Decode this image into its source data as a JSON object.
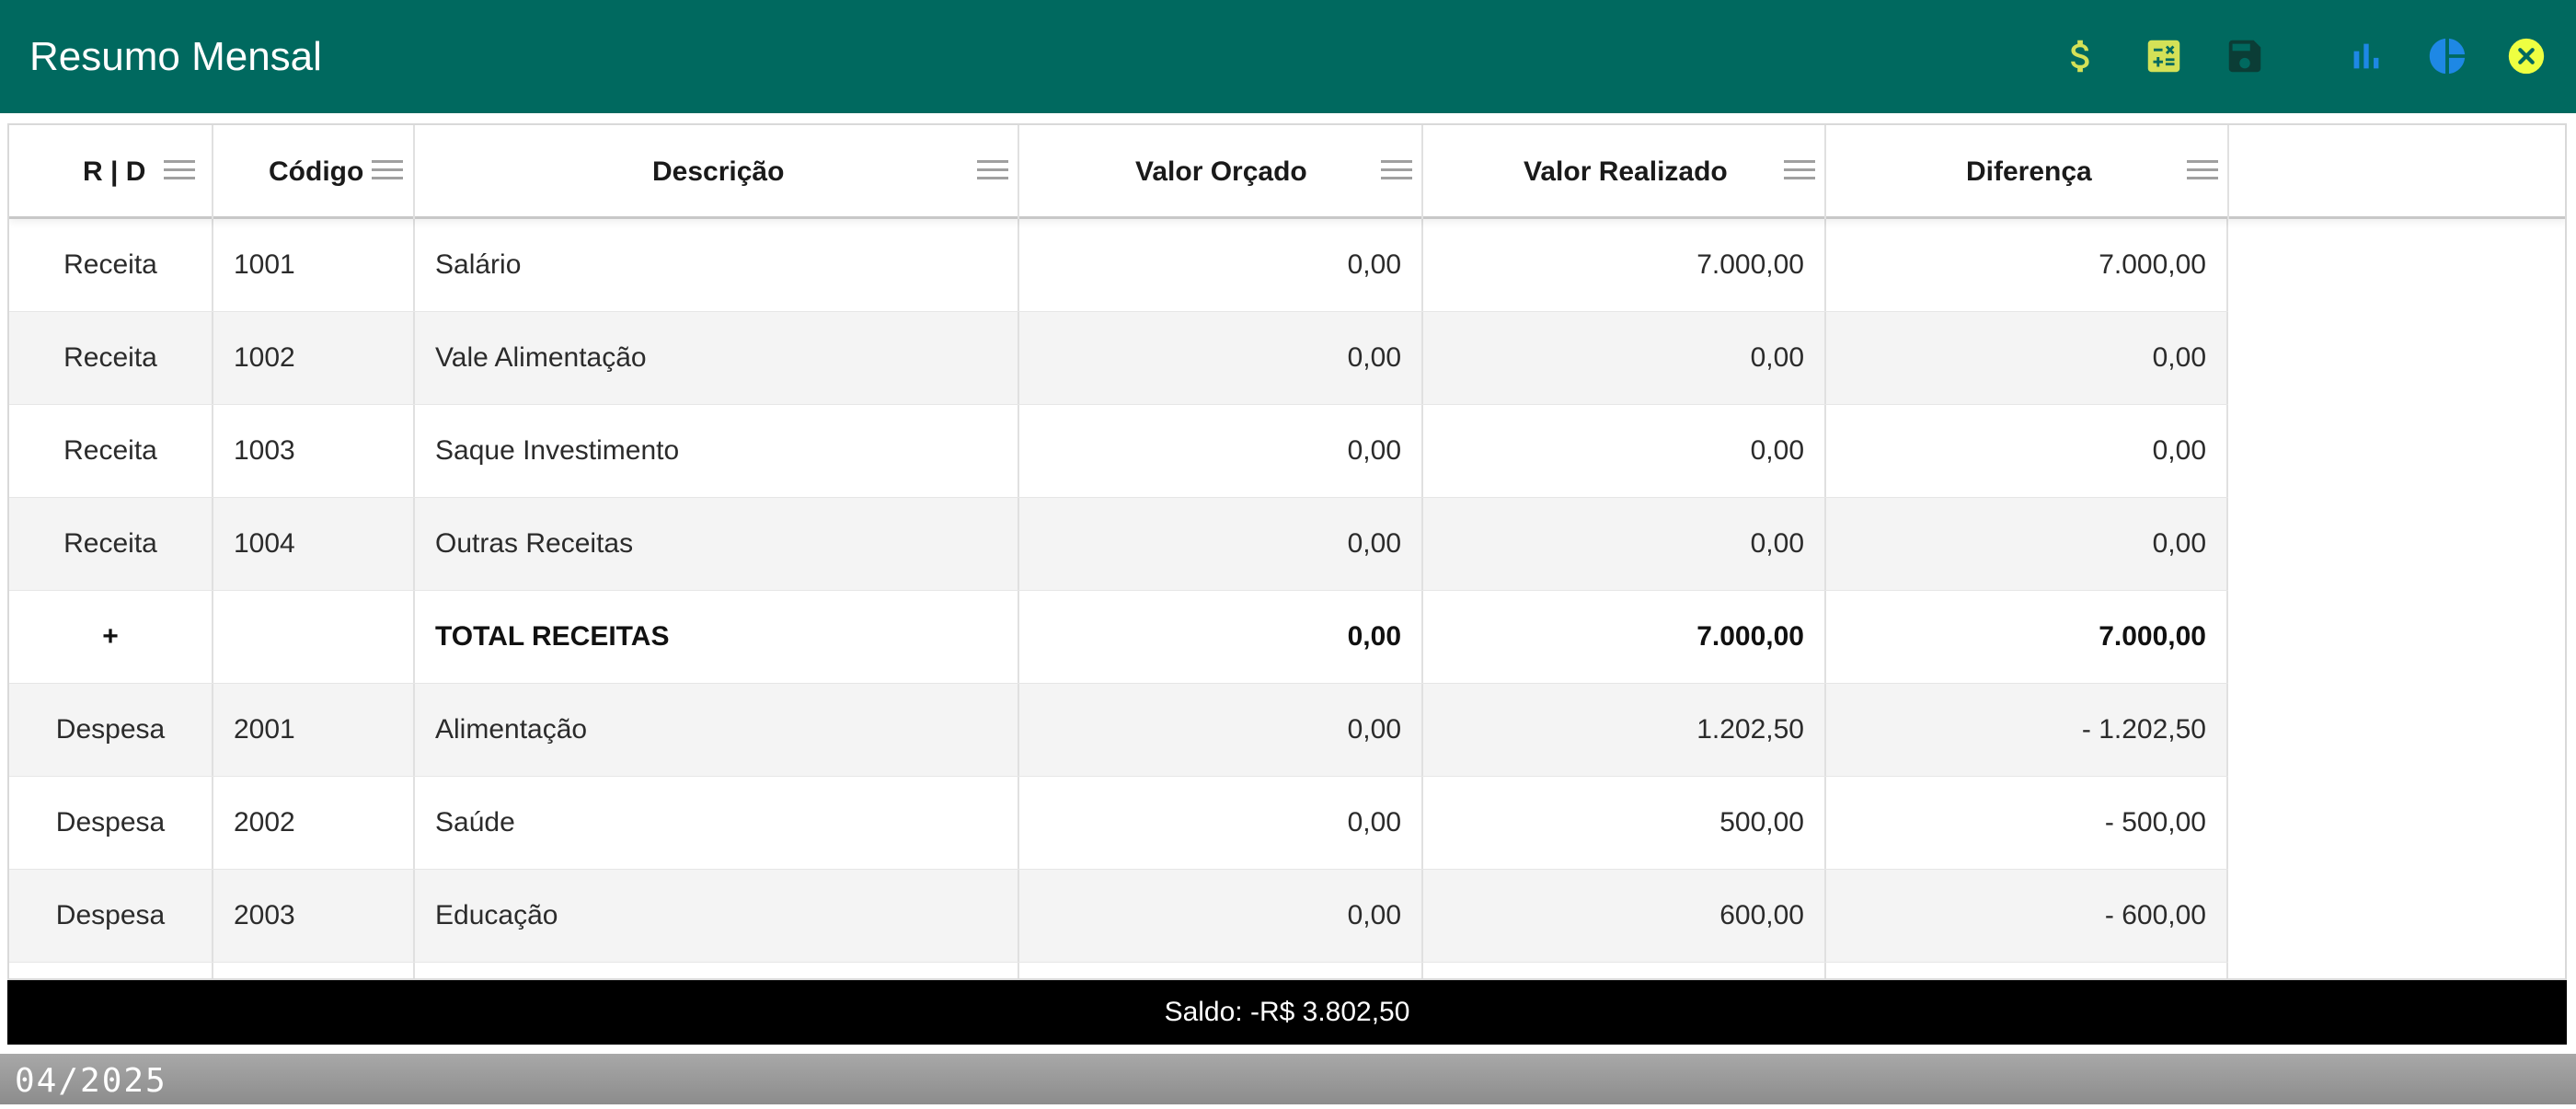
{
  "window": {
    "title": "Resumo Mensal"
  },
  "toolbar": {
    "icons": [
      {
        "name": "dollar-icon",
        "color": "#d4e157"
      },
      {
        "name": "calculator-icon",
        "color": "#d4e157"
      },
      {
        "name": "save-icon",
        "color": "#004d40"
      },
      {
        "name": "bar-chart-icon",
        "color": "#1e88e5"
      },
      {
        "name": "pie-chart-icon",
        "color": "#1e88e5"
      },
      {
        "name": "close-icon",
        "color": "#eeff41"
      }
    ]
  },
  "table": {
    "headers": [
      "R | D",
      "Código",
      "Descrição",
      "Valor Orçado",
      "Valor Realizado",
      "Diferença"
    ],
    "rows": [
      {
        "rd": "Receita",
        "codigo": "1001",
        "descricao": "Salário",
        "orcado": "0,00",
        "realizado": "7.000,00",
        "diferenca": "7.000,00"
      },
      {
        "rd": "Receita",
        "codigo": "1002",
        "descricao": "Vale Alimentação",
        "orcado": "0,00",
        "realizado": "0,00",
        "diferenca": "0,00"
      },
      {
        "rd": "Receita",
        "codigo": "1003",
        "descricao": "Saque Investimento",
        "orcado": "0,00",
        "realizado": "0,00",
        "diferenca": "0,00"
      },
      {
        "rd": "Receita",
        "codigo": "1004",
        "descricao": "Outras Receitas",
        "orcado": "0,00",
        "realizado": "0,00",
        "diferenca": "0,00"
      },
      {
        "rd": "+",
        "codigo": "",
        "descricao": "TOTAL RECEITAS",
        "orcado": "0,00",
        "realizado": "7.000,00",
        "diferenca": "7.000,00"
      },
      {
        "rd": "Despesa",
        "codigo": "2001",
        "descricao": "Alimentação",
        "orcado": "0,00",
        "realizado": "1.202,50",
        "diferenca": "- 1.202,50"
      },
      {
        "rd": "Despesa",
        "codigo": "2002",
        "descricao": "Saúde",
        "orcado": "0,00",
        "realizado": "500,00",
        "diferenca": "- 500,00"
      },
      {
        "rd": "Despesa",
        "codigo": "2003",
        "descricao": "Educação",
        "orcado": "0,00",
        "realizado": "600,00",
        "diferenca": "- 600,00"
      }
    ]
  },
  "footer": {
    "saldo": "Saldo: -R$ 3.802,50"
  },
  "status": {
    "period": "04/2025"
  }
}
